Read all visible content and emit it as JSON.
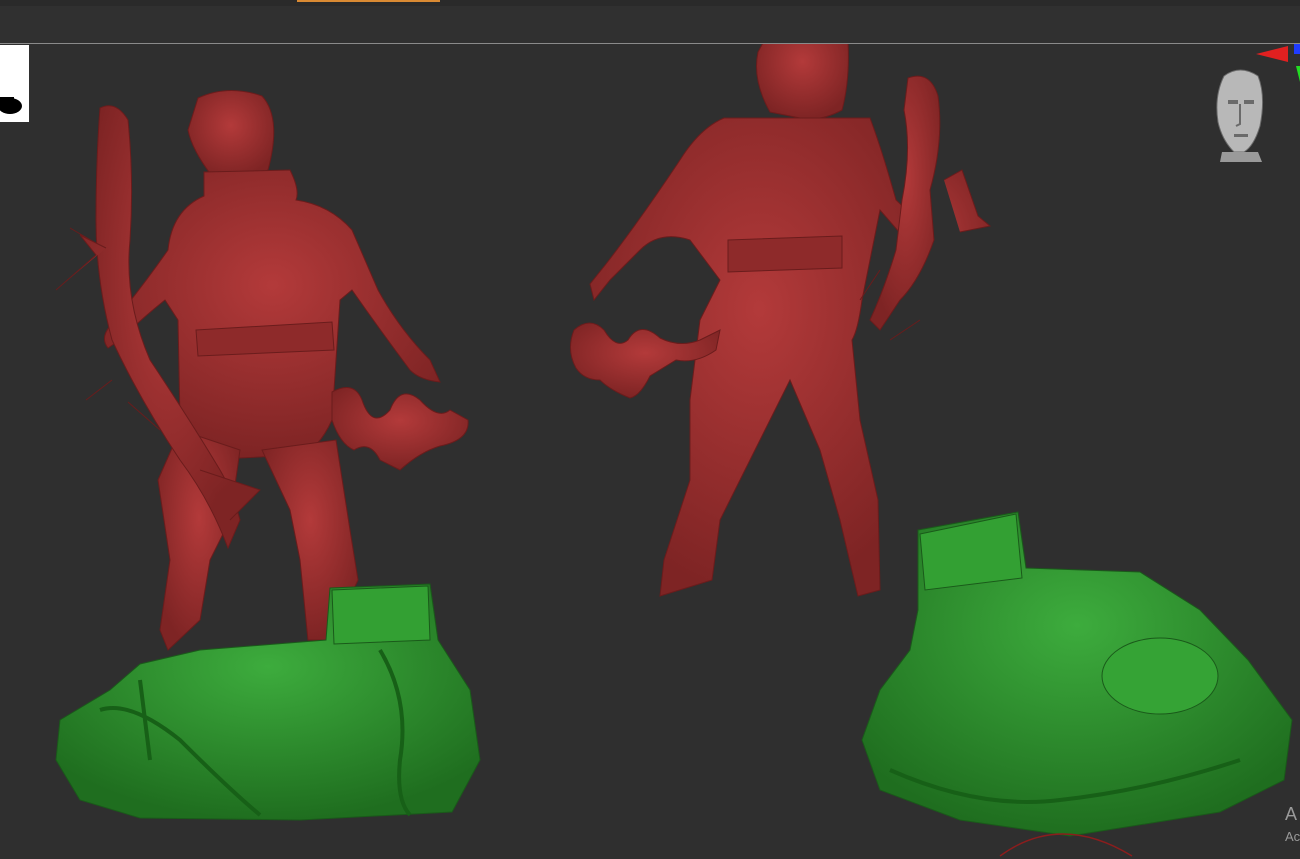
{
  "app": {
    "accent_color": "#d98a33"
  },
  "viewport": {
    "background_color": "#2f2f2f",
    "model_colors": {
      "figure": "#9e2d2d",
      "base": "#2f8f2f"
    },
    "objects": [
      {
        "name": "archer-back-view"
      },
      {
        "name": "archer-front-view"
      },
      {
        "name": "base-left"
      },
      {
        "name": "base-right"
      }
    ]
  },
  "navigation": {
    "head_icon": "head-gizmo-icon",
    "axis_icon": "axis-gizmo-icon"
  },
  "watermark": {
    "line1": "A",
    "line2": "Ac"
  }
}
